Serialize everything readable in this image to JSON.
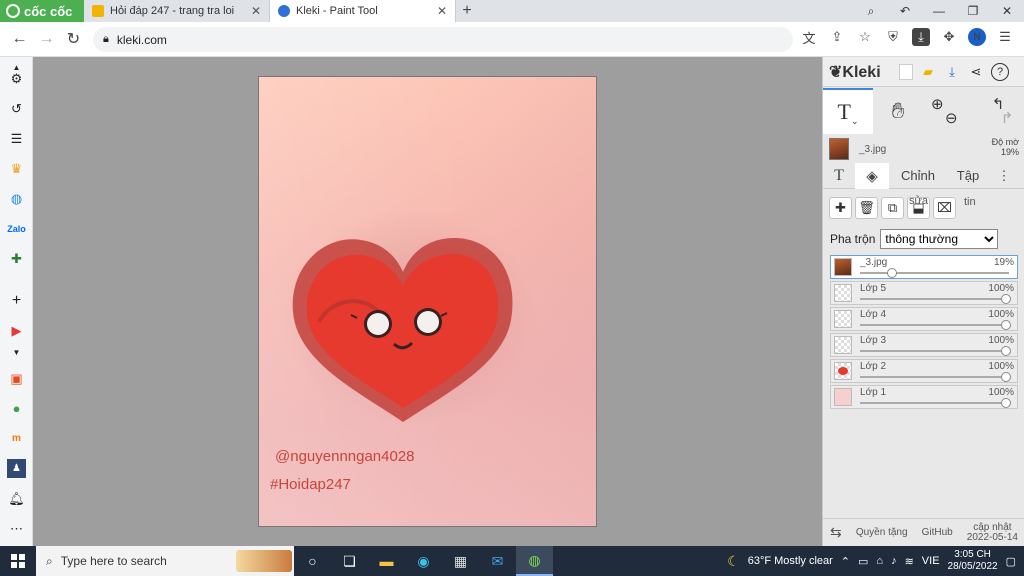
{
  "browser": {
    "brand": "cốc cốc",
    "tabs": [
      {
        "title": "Hỏi đáp 247 - trang tra loi",
        "active": false
      },
      {
        "title": "Kleki - Paint Tool",
        "active": true
      }
    ],
    "url": "kleki.com",
    "profile_initial": "N"
  },
  "sidebar": {
    "icons": [
      "gear-icon",
      "history-icon",
      "list-icon",
      "crown-icon",
      "messenger-icon",
      "zalo-icon",
      "gamepad-icon",
      "plus-icon",
      "youtube-icon",
      "chevron-down-icon",
      "shop-icon",
      "chat-icon",
      "m-icon",
      "person-icon",
      "bell-icon",
      "more-icon"
    ]
  },
  "canvas": {
    "watermark_user": "@nguyennngan4028",
    "watermark_tag": "#Hoidap247",
    "colors": {
      "heart": "#e63a2e",
      "heart_outline": "#c2403a"
    }
  },
  "kleki": {
    "title": "Kleki",
    "current_layer_name": "_3.jpg",
    "opacity_label": "Độ mờ",
    "opacity_value": "19%",
    "subtabs": [
      "T",
      "Chỉnh",
      "Tập"
    ],
    "sua_label": "sửa",
    "tin_label": "tin",
    "blend_label": "Pha trộn",
    "blend_value": "thông thường",
    "layers": [
      {
        "name": "_3.jpg",
        "percent": "19%",
        "level": 0.19
      },
      {
        "name": "Lớp 5",
        "percent": "100%",
        "level": 1
      },
      {
        "name": "Lớp 4",
        "percent": "100%",
        "level": 1
      },
      {
        "name": "Lớp 3",
        "percent": "100%",
        "level": 1
      },
      {
        "name": "Lớp 2",
        "percent": "100%",
        "level": 1
      },
      {
        "name": "Lớp 1",
        "percent": "100%",
        "level": 1
      }
    ],
    "footer": {
      "privacy": "Quyền tặng",
      "github": "GitHub",
      "update_label": "cập nhật",
      "update_date": "2022-05-14"
    }
  },
  "taskbar": {
    "search_placeholder": "Type here to search",
    "weather": "63°F  Mostly clear",
    "language": "VIE",
    "time": "3:05 CH",
    "date": "28/05/2022"
  }
}
